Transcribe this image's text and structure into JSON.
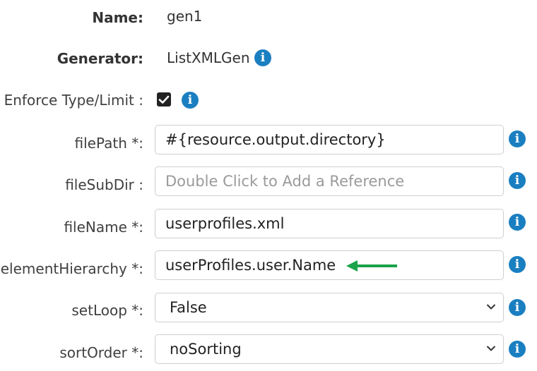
{
  "form": {
    "name": {
      "label": "Name:",
      "value": "gen1"
    },
    "generator": {
      "label": "Generator:",
      "value": "ListXMLGen"
    },
    "enforce": {
      "label": "Enforce Type/Limit :",
      "checked": true
    },
    "filePath": {
      "label": "filePath *:",
      "value": "#{resource.output.directory}"
    },
    "fileSubDir": {
      "label": "fileSubDir :",
      "placeholder": "Double Click to Add a Reference"
    },
    "fileName": {
      "label": "fileName *:",
      "value": "userprofiles.xml"
    },
    "elementHierarchy": {
      "label": "elementHierarchy *:",
      "value": "userProfiles.user.Name"
    },
    "setLoop": {
      "label": "setLoop *:",
      "selected": "False"
    },
    "sortOrder": {
      "label": "sortOrder *:",
      "selected": "noSorting"
    }
  },
  "icons": {
    "info": "info-icon",
    "checkmark": "checkmark-icon",
    "chevron": "chevron-down-icon",
    "arrow": "arrow-left-icon"
  },
  "colors": {
    "info_blue": "#1a7fc1",
    "arrow_green": "#1aa34a"
  }
}
